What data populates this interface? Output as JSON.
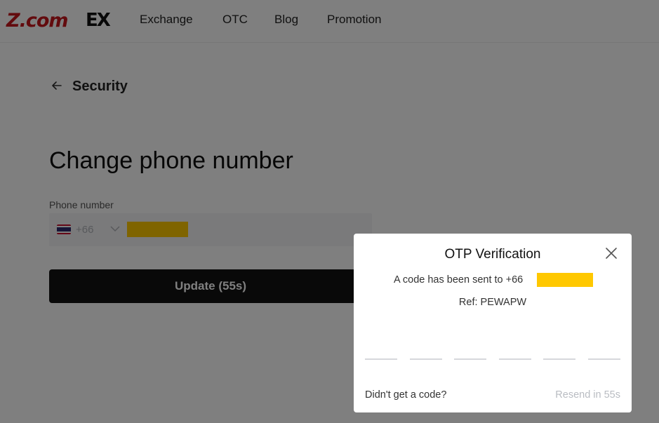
{
  "header": {
    "logo_text": "Z.com",
    "logo_suffix": "EX",
    "nav": [
      "Exchange",
      "OTC",
      "Blog",
      "Promotion"
    ]
  },
  "page": {
    "back_label": "Security",
    "title": "Change phone number",
    "phone_label": "Phone number",
    "country_code": "+66",
    "update_button": "Update (55s)"
  },
  "modal": {
    "title": "OTP Verification",
    "sent_text": "A code has been sent to +66",
    "ref_text": "Ref: PEWAPW",
    "otp_digits": 6,
    "no_code_text": "Didn't get a code?",
    "resend_text": "Resend in 55s"
  },
  "colors": {
    "brand_red": "#c7161d",
    "redaction": "#ffc800",
    "button_dark": "#121212",
    "overlay": "rgba(0,0,0,0.5)"
  },
  "icons": [
    "back-arrow-icon",
    "thailand-flag-icon",
    "chevron-down-icon",
    "close-icon"
  ]
}
